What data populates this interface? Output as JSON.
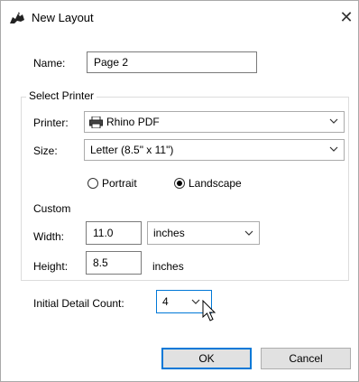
{
  "window": {
    "title": "New Layout"
  },
  "name": {
    "label": "Name:",
    "value": "Page 2"
  },
  "select_printer": {
    "legend": "Select Printer",
    "printer": {
      "label": "Printer:",
      "value": "Rhino PDF",
      "icon": "printer-icon"
    },
    "size": {
      "label": "Size:",
      "value": "Letter (8.5\" x 11\")"
    },
    "orientation": {
      "portrait_label": "Portrait",
      "landscape_label": "Landscape",
      "selected": "Landscape"
    },
    "custom": {
      "label": "Custom",
      "width": {
        "label": "Width:",
        "value": "11.0",
        "units": "inches"
      },
      "height": {
        "label": "Height:",
        "value": "8.5",
        "units": "inches"
      }
    }
  },
  "initial_detail_count": {
    "label": "Initial Detail Count:",
    "value": "4"
  },
  "buttons": {
    "ok": "OK",
    "cancel": "Cancel"
  },
  "colors": {
    "accent": "#0078d7",
    "button_bg": "#e1e1e1"
  }
}
